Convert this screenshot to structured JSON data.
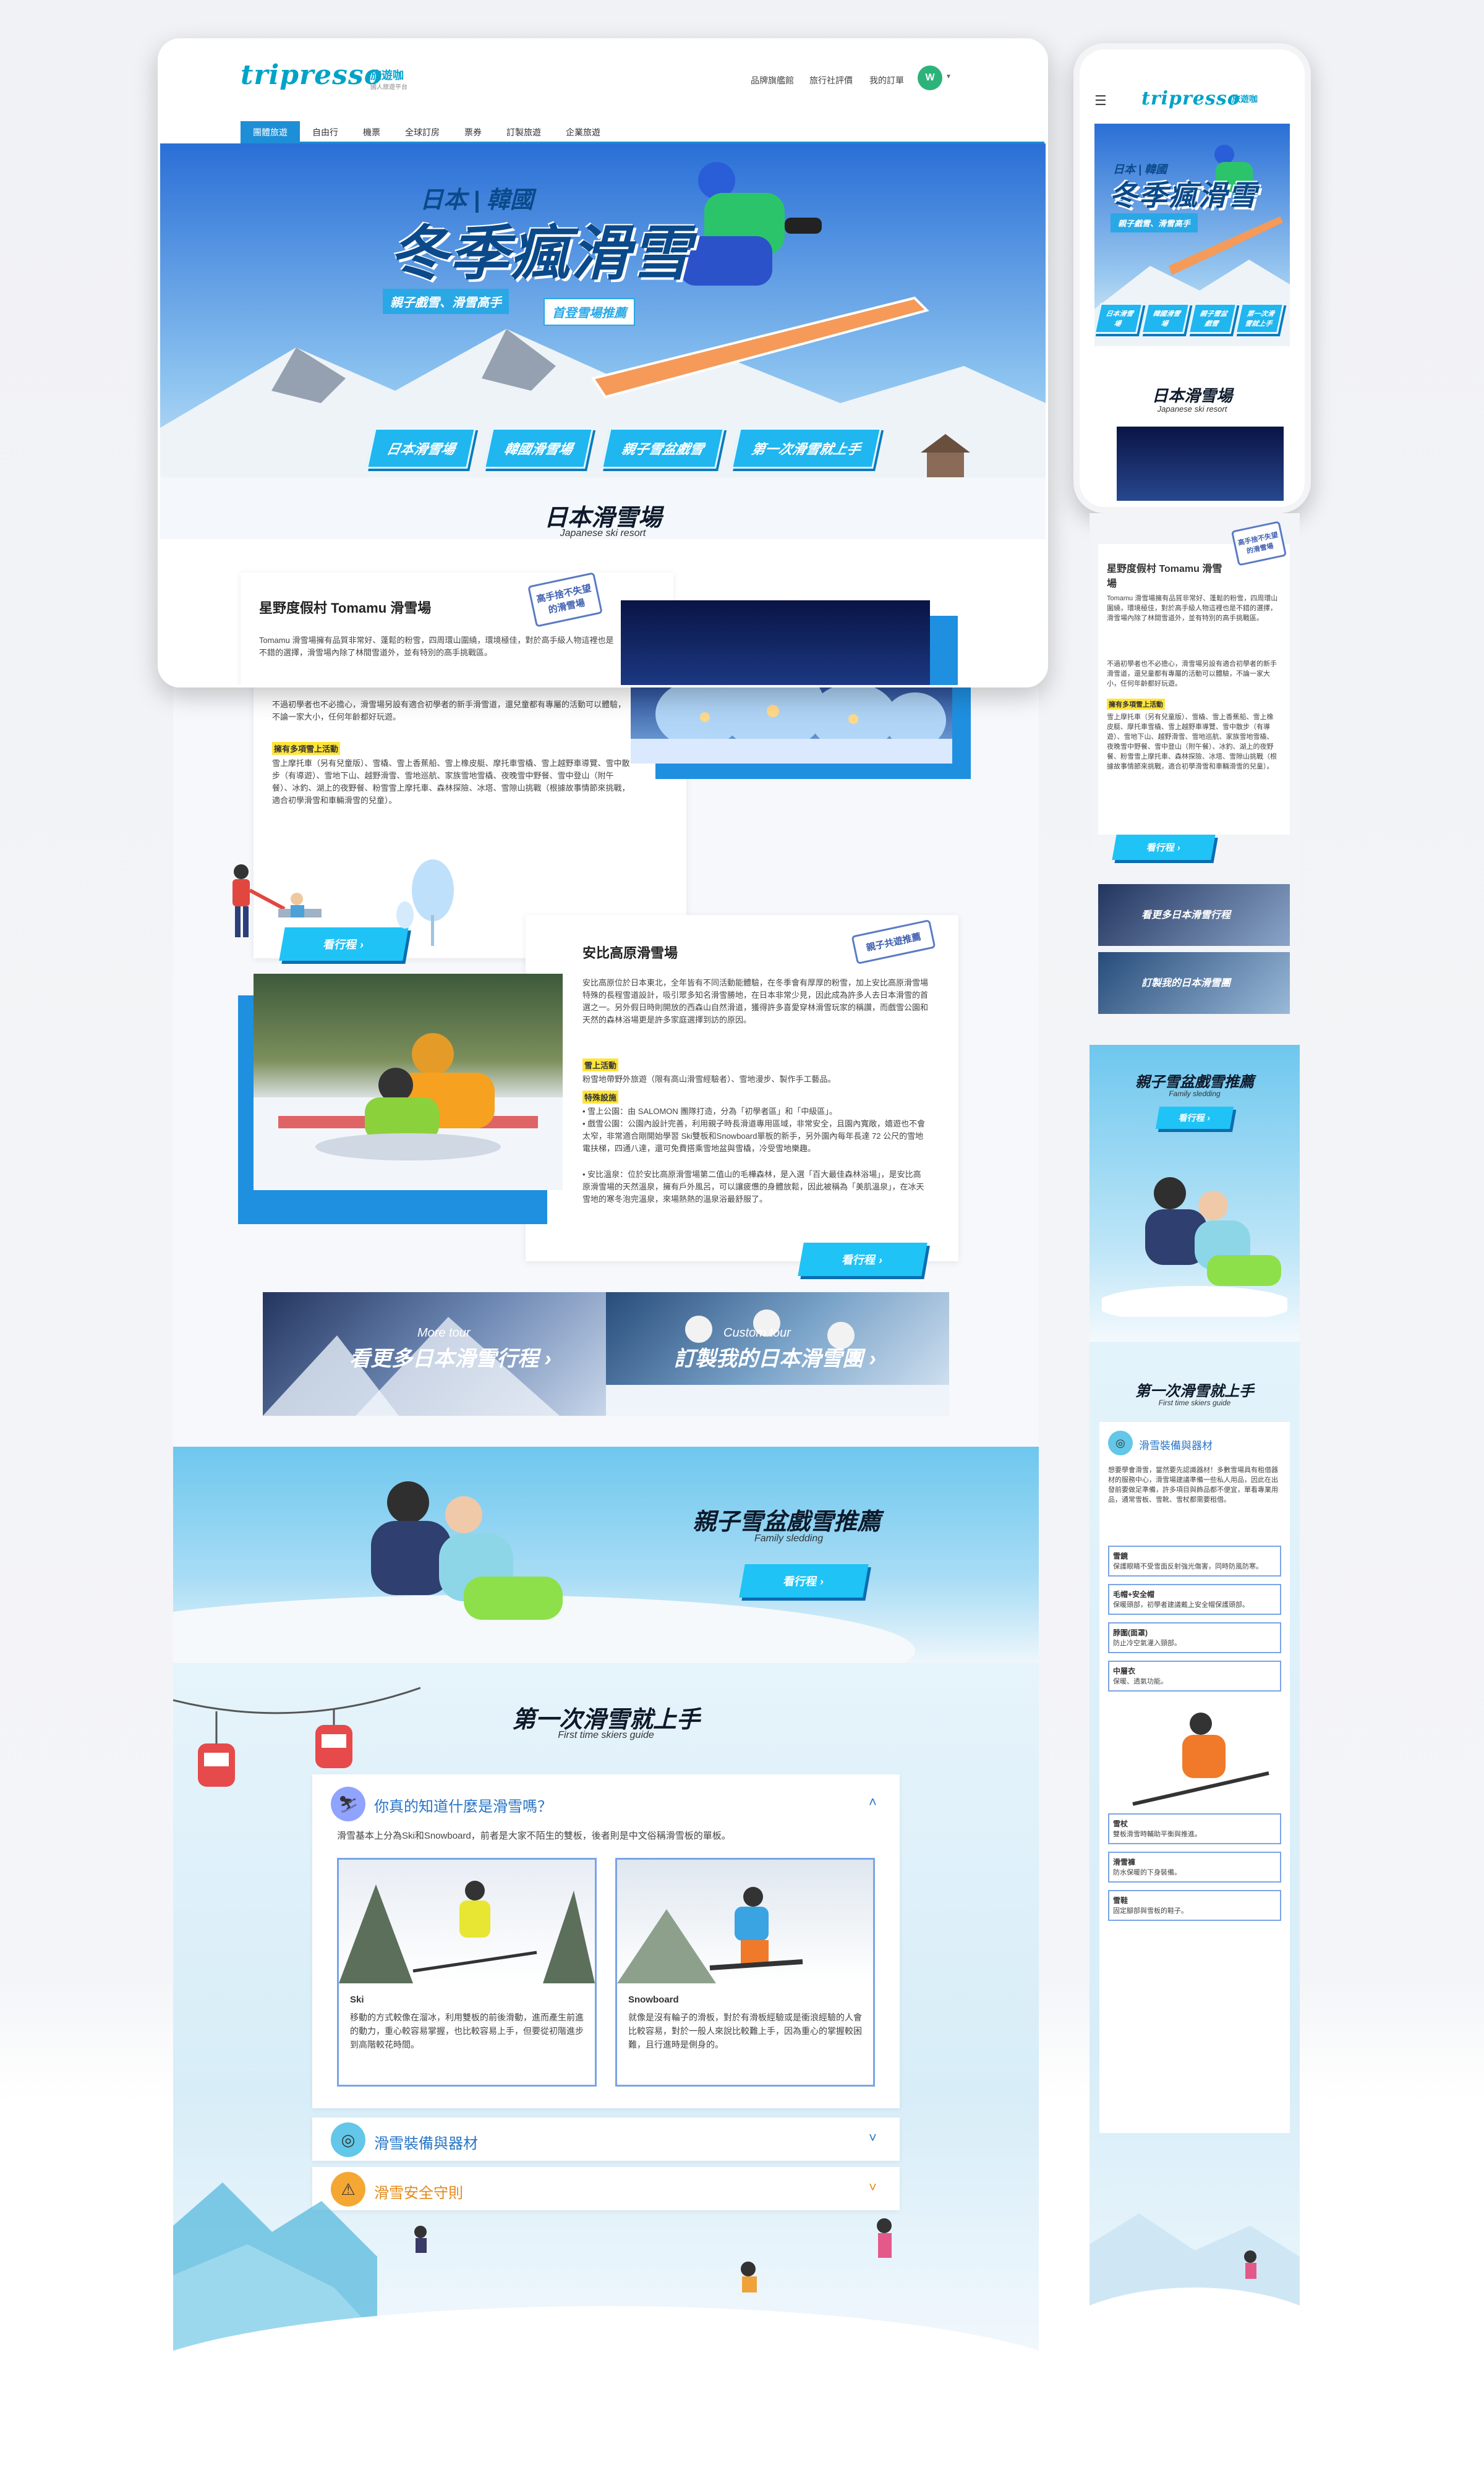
{
  "brand": {
    "logo": "tripresso",
    "logo_zh": "旅遊咖",
    "logo_sub": "國人旅遊平台",
    "accent": "#1e8ed6",
    "cta_color": "#20c3f5"
  },
  "header": {
    "links": [
      "品牌旗艦館",
      "旅行社評價",
      "我的訂單"
    ],
    "avatar": "W",
    "menu_icon": "hamburger-icon"
  },
  "tabs": [
    "團體旅遊",
    "自由行",
    "機票",
    "全球訂房",
    "票券",
    "訂製旅遊",
    "企業旅遊"
  ],
  "hero": {
    "title_small": "日本 | 韓國",
    "title_big": "冬季瘋滑雪",
    "tag1": "親子戲雪、滑雪高手",
    "tag2": "首登雪場推薦",
    "buttons": [
      "日本滑雪場",
      "韓國滑雪場",
      "親子雪盆戲雪",
      "第一次滑雪就上手"
    ]
  },
  "japan_section": {
    "title": "日本滑雪場",
    "subtitle": "Japanese ski resort"
  },
  "tomamu": {
    "title": "星野度假村 Tomamu 滑雪場",
    "stamp": "高手捨不失望的滑雪場",
    "intro": "Tomamu 滑雪場擁有品質非常好、蓬鬆的粉雪，四周環山圍繞，環境極佳，對於高手級人物這裡也是不錯的選擇，滑雪場內除了林間雪道外，並有特別的高手挑戰區。",
    "intro2": "不過初學者也不必擔心，滑雪場另設有適合初學者的新手滑雪道，還兒童都有專屬的活動可以體驗，不論一家大小，任何年齡都好玩遊。",
    "hl_label": "擁有多項雪上活動",
    "activities": "雪上摩托車（另有兒童版）、雪橇、雪上香蕉船、雪上橡皮艇、摩托車雪橇、雪上越野車導覽、雪中散步（有導遊）、雪地下山、越野滑雪、雪地巡航、家族雪地雪橇、夜晚雪中野餐、雪中登山（附午餐）、冰釣、湖上的夜野餐、粉雪雪上摩托車、森林探險、冰塔、雪隙山挑戰（根據故事情節來挑戰，適合初學滑雪和車輛滑雪的兒童）。",
    "cta": "看行程"
  },
  "appi": {
    "title": "安比高原滑雪場",
    "stamp": "親子共遊推薦",
    "intro": "安比高原位於日本東北，全年皆有不同活動能體驗，在冬季會有厚厚的粉雪，加上安比高原滑雪場特殊的長程雪道設計，吸引眾多知名滑雪勝地，在日本非常少見，因此成為許多人去日本滑雪的首選之一。另外假日時則開放的西森山自然滑道，獲得許多喜愛穿林滑雪玩家的稱讚，而戲雪公園和天然的森林浴場更是許多家庭選擇到訪的原因。",
    "hl1": "雪上活動",
    "act1": "粉雪地帶野外旅遊（限有高山滑雪經驗者）、雪地漫步、製作手工藝品。",
    "hl2": "特殊設施",
    "fac1": "• 雪上公園：由 SALOMON 團隊打造，分為「初學者區」和「中級區」。",
    "fac2": "• 戲雪公園：公園內設計完善，利用親子時長滑道專用區域，非常安全，且園內寬敞，嬉遊也不會太窄，非常適合剛開始學習 Ski雙板和Snowboard單板的新手，另外園內每年長達 72 公尺的雪地電扶梯，四通八達，還可免費搭乘雪地盆與雪橇，冷受雪地樂趣。",
    "fac3": "• 安比溫泉：位於安比高原滑雪場第二值山的毛樺森林，是入選「百大最佳森林浴場」，是安比高原滑雪場的天然溫泉，擁有戶外風呂，可以讓疲憊的身體放鬆，因此被稱為「美肌溫泉」，在冰天雪地的寒冬泡完溫泉，來場熱熱的溫泉浴最舒服了。",
    "cta": "看行程"
  },
  "banners": [
    {
      "small": "More tour",
      "big": "看更多日本滑雪行程"
    },
    {
      "small": "Custom tour",
      "big": "訂製我的日本滑雪團"
    }
  ],
  "sledding": {
    "title": "親子雪盆戲雪推薦",
    "subtitle": "Family sledding",
    "cta": "看行程"
  },
  "guide": {
    "title": "第一次滑雪就上手",
    "subtitle": "First time skiers guide",
    "q1": "你真的知道什麼是滑雪嗎？",
    "q1_intro": "滑雪基本上分為Ski和Snowboard，前者是大家不陌生的雙板，後者則是中文俗稱滑雪板的單板。",
    "ski_title": "Ski",
    "ski_desc": "移動的方式較像在溜冰，利用雙板的前後滑動，進而產生前進的動力，重心較容易掌握，也比較容易上手，但要從初階進步到高階較花時間。",
    "snow_title": "Snowboard",
    "snow_desc": "就像是沒有輪子的滑板，對於有滑板經驗或是衝浪經驗的人會比較容易，對於一般人來說比較難上手，因為重心的掌握較困難，且行進時是側身的。",
    "q2": "滑雪裝備與器材",
    "q3": "滑雪安全守則"
  },
  "mobile": {
    "hero_buttons": [
      "日本滑雪場",
      "韓國滑雪場",
      "親子雪盆戲雪",
      "第一次滑雪就上手"
    ],
    "equip_title": "滑雪裝備與器材",
    "equip_intro": "想要學會滑雪，當然要先認識器材！多數雪場具有租借器材的服務中心，滑雪場建議準備一些私人用品，因此在出發前要做足準備，許多項目與飾品都不便宜，單看專業用品，通常雪板、雪靴、雪杖都需要租借。",
    "equip_items": [
      {
        "name": "雪鏡",
        "desc": "保護眼睛不受雪面反射強光傷害，同時防風防寒。"
      },
      {
        "name": "毛帽+安全帽",
        "desc": "保暖頭部，初學者建議戴上安全帽保護頭部。"
      },
      {
        "name": "脖圍(面罩)",
        "desc": "防止冷空氣灌入頸部。"
      },
      {
        "name": "中層衣",
        "desc": "保暖、透氣功能。"
      },
      {
        "name": "雪杖",
        "desc": "雙板滑雪時輔助平衡與推進。"
      },
      {
        "name": "滑雪褲",
        "desc": "防水保暖的下身裝備。"
      },
      {
        "name": "雪鞋",
        "desc": "固定腳部與雪板的鞋子。"
      }
    ]
  }
}
